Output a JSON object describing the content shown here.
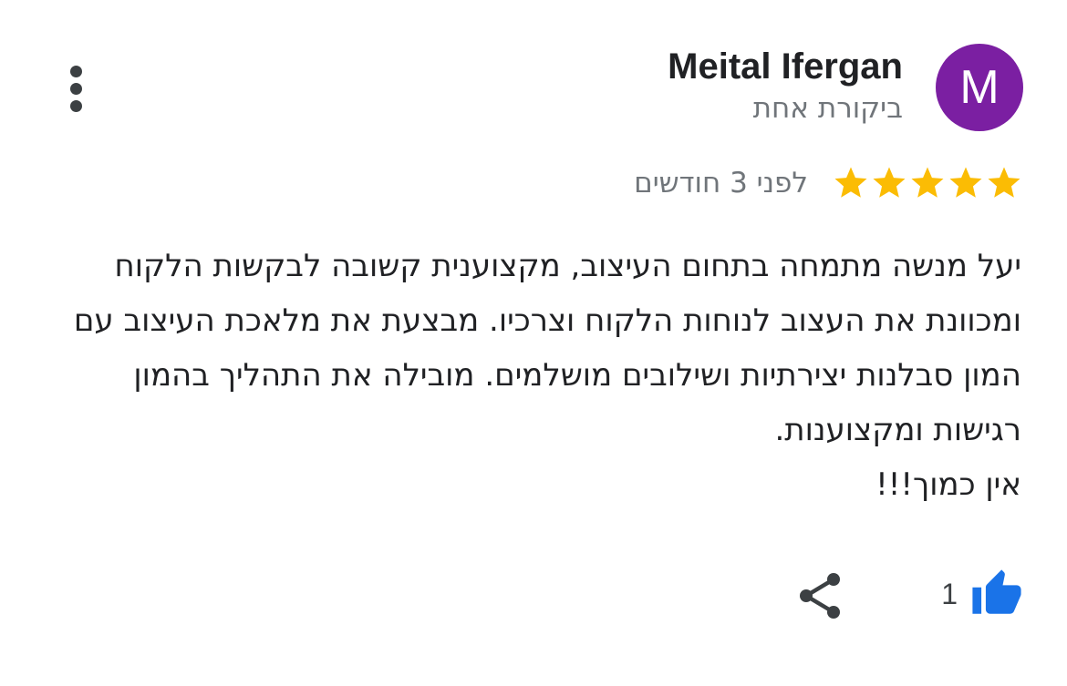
{
  "reviewer": {
    "initial": "M",
    "avatar_color": "#7b1fa2",
    "name": "Meital Ifergan",
    "meta": "ביקורת אחת"
  },
  "rating": {
    "stars": 5,
    "max_stars": 5,
    "star_color": "#fbbc04",
    "time": "לפני 3 חודשים"
  },
  "review": {
    "text": "יעל מנשה מתמחה בתחום העיצוב, מקצוענית קשובה לבקשות הלקוח ומכוונת את העצוב לנוחות הלקוח וצרכיו. מבצעת את מלאכת העיצוב עם המון סבלנות יצירתיות ושילובים מושלמים. מובילה את התהליך בהמון רגישות ומקצוענות.",
    "closing": "אין כמוך!!!"
  },
  "actions": {
    "like_count": "1",
    "like_color": "#1a73e8",
    "share_icon": "share-icon",
    "menu_icon": "more-vert-icon",
    "like_icon": "thumb-up-icon"
  }
}
